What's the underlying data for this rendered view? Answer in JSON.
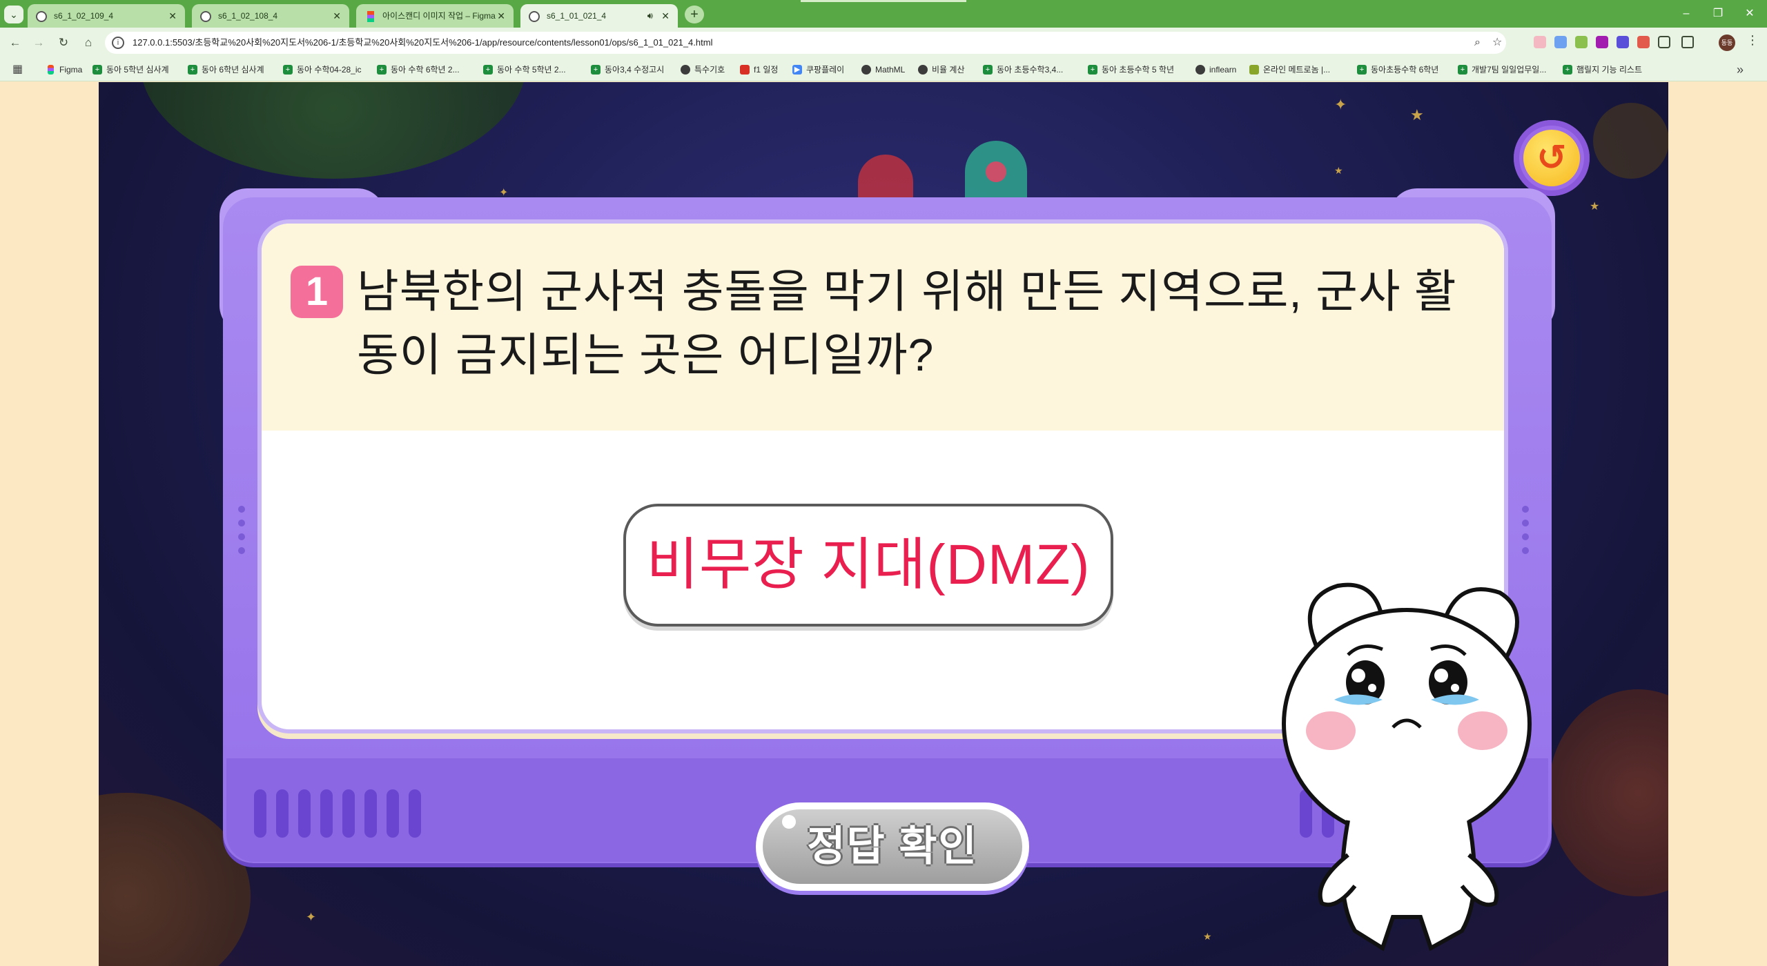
{
  "browser": {
    "tabs": [
      {
        "title": "s6_1_02_109_4",
        "active": false
      },
      {
        "title": "s6_1_02_108_4",
        "active": false
      },
      {
        "title": "아이스캔디 이미지 작업 – Figma",
        "active": false
      },
      {
        "title": "s6_1_01_021_4",
        "active": true
      }
    ],
    "url": "127.0.0.1:5503/초등학교%20사회%20지도서%206-1/초등학교%20사회%20지도서%206-1/app/resource/contents/lesson01/ops/s6_1_01_021_4.html",
    "bookmarks": [
      "Figma",
      "동아 5학년 심사계",
      "동아 6학년 심사계",
      "동아 수학04-28_ic",
      "동아 수학 6학년 2...",
      "동아 수학 5학년 2...",
      "동아3,4 수정고시",
      "특수기호",
      "f1 일정",
      "쿠팡플레이",
      "MathML",
      "비율 계산",
      "동아 초등수학3,4...",
      "동아 초등수학 5 학년",
      "inflearn",
      "온라인 메트로놈 |...",
      "동아초등수학 6학년",
      "개발7팀 일일업무일...",
      "햄릴지 기능 리스트"
    ],
    "profile_initials": "동동"
  },
  "quiz": {
    "number": "1",
    "question": "남북한의 군사적 충돌을 막기 위해 만든 지역으로, 군사 활동이 금지되는 곳은 어디일까?",
    "question_line1": "남북한의 군사적 충돌을 막기 위해 만든 지역으로, 군사 활",
    "question_line2": "동이 금지되는 곳은 어디일까?",
    "answer": "비무장 지대(DMZ)",
    "check_button": "정답 확인"
  },
  "colors": {
    "browser_green": "#58a845",
    "panel_purple": "#9571ea",
    "number_badge": "#f56f9b",
    "answer_text": "#e9204f",
    "check_button": "#b6b6b6"
  },
  "icons": [
    "back-icon",
    "close-icon",
    "reload-icon",
    "home-icon",
    "star-icon",
    "search-icon",
    "restart-icon"
  ]
}
